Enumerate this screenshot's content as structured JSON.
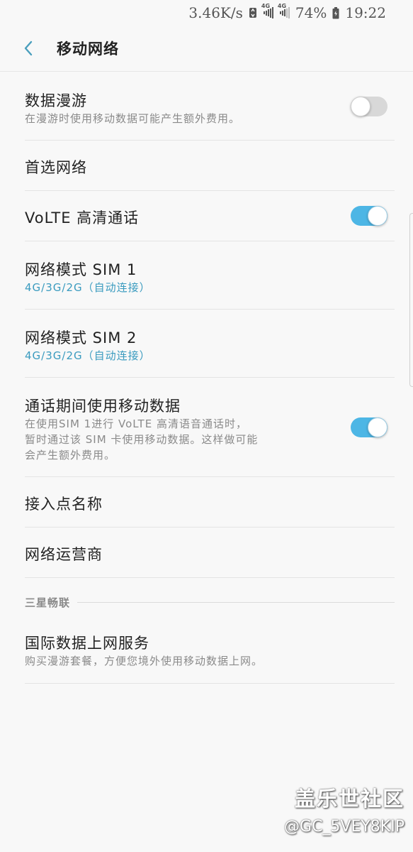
{
  "status_bar": {
    "speed": "3.46K/s",
    "network1": "4G",
    "network2": "4G",
    "battery": "74%",
    "time": "19:22"
  },
  "header": {
    "title": "移动网络",
    "back_icon": "chevron-left-icon",
    "accent": "#4a9fbd"
  },
  "items": [
    {
      "title": "数据漫游",
      "subtitle": "在漫游时使用移动数据可能产生额外费用。",
      "toggle": "off"
    },
    {
      "title": "首选网络"
    },
    {
      "title": "VoLTE 高清通话",
      "toggle": "on"
    },
    {
      "title": "网络模式 SIM 1",
      "subtitle": "4G/3G/2G（自动连接）"
    },
    {
      "title": "网络模式 SIM 2",
      "subtitle": "4G/3G/2G（自动连接）"
    },
    {
      "title": "通话期间使用移动数据",
      "subtitle_lines": [
        "在使用SIM 1进行 VoLTE 高清语音通话时，",
        "暂时通过该 SIM 卡使用移动数据。这样做可能",
        "会产生额外费用。"
      ],
      "toggle": "on"
    },
    {
      "title": "接入点名称"
    },
    {
      "title": "网络运营商"
    }
  ],
  "section": {
    "title": "三星畅联"
  },
  "section_items": [
    {
      "title": "国际数据上网服务",
      "subtitle": "购买漫游套餐，方便您境外使用移动数据上网。"
    }
  ],
  "watermark": {
    "line1": "盖乐世社区",
    "line2": "@GC_5VEY8KIP"
  },
  "colors": {
    "toggle_on": "#4db6e5",
    "toggle_off": "#d8d8d8",
    "subtitle_blue": "#3a9bbf"
  }
}
